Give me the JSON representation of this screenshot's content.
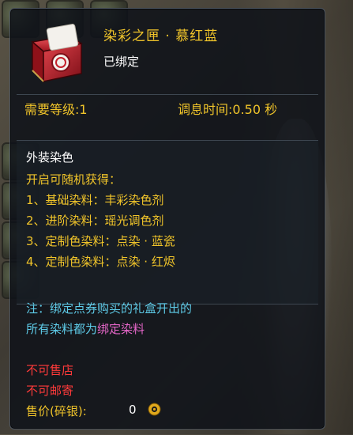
{
  "item": {
    "name": "染彩之匣 · 慕红蓝",
    "bound_status": "已绑定",
    "icon": "red-gift-box-icon"
  },
  "requirements": {
    "level_label": "需要等级:1",
    "cooldown_label": "调息时间:0.50 秒"
  },
  "section": {
    "title": "外装染色",
    "lines": [
      "开启可随机获得：",
      "1、基础染料：丰彩染色剂",
      "2、进阶染料：瑶光调色剂",
      "3、定制色染料：点染 · 蓝瓷",
      "4、定制色染料：点染 · 红烬"
    ]
  },
  "note": {
    "line1": "注：绑定点券购买的礼盒开出的",
    "line2_prefix": "所有染料都为",
    "line2_highlight": "绑定染料"
  },
  "restrictions": {
    "no_sell": "不可售店",
    "no_mail": "不可邮寄"
  },
  "price": {
    "label": "售价(碎银):",
    "value": "0",
    "icon": "silver-coin-icon"
  },
  "colors": {
    "gold": "#f0c42a",
    "cyan": "#5ecbe8",
    "pink": "#e566c8",
    "red": "#ff3a3a"
  }
}
